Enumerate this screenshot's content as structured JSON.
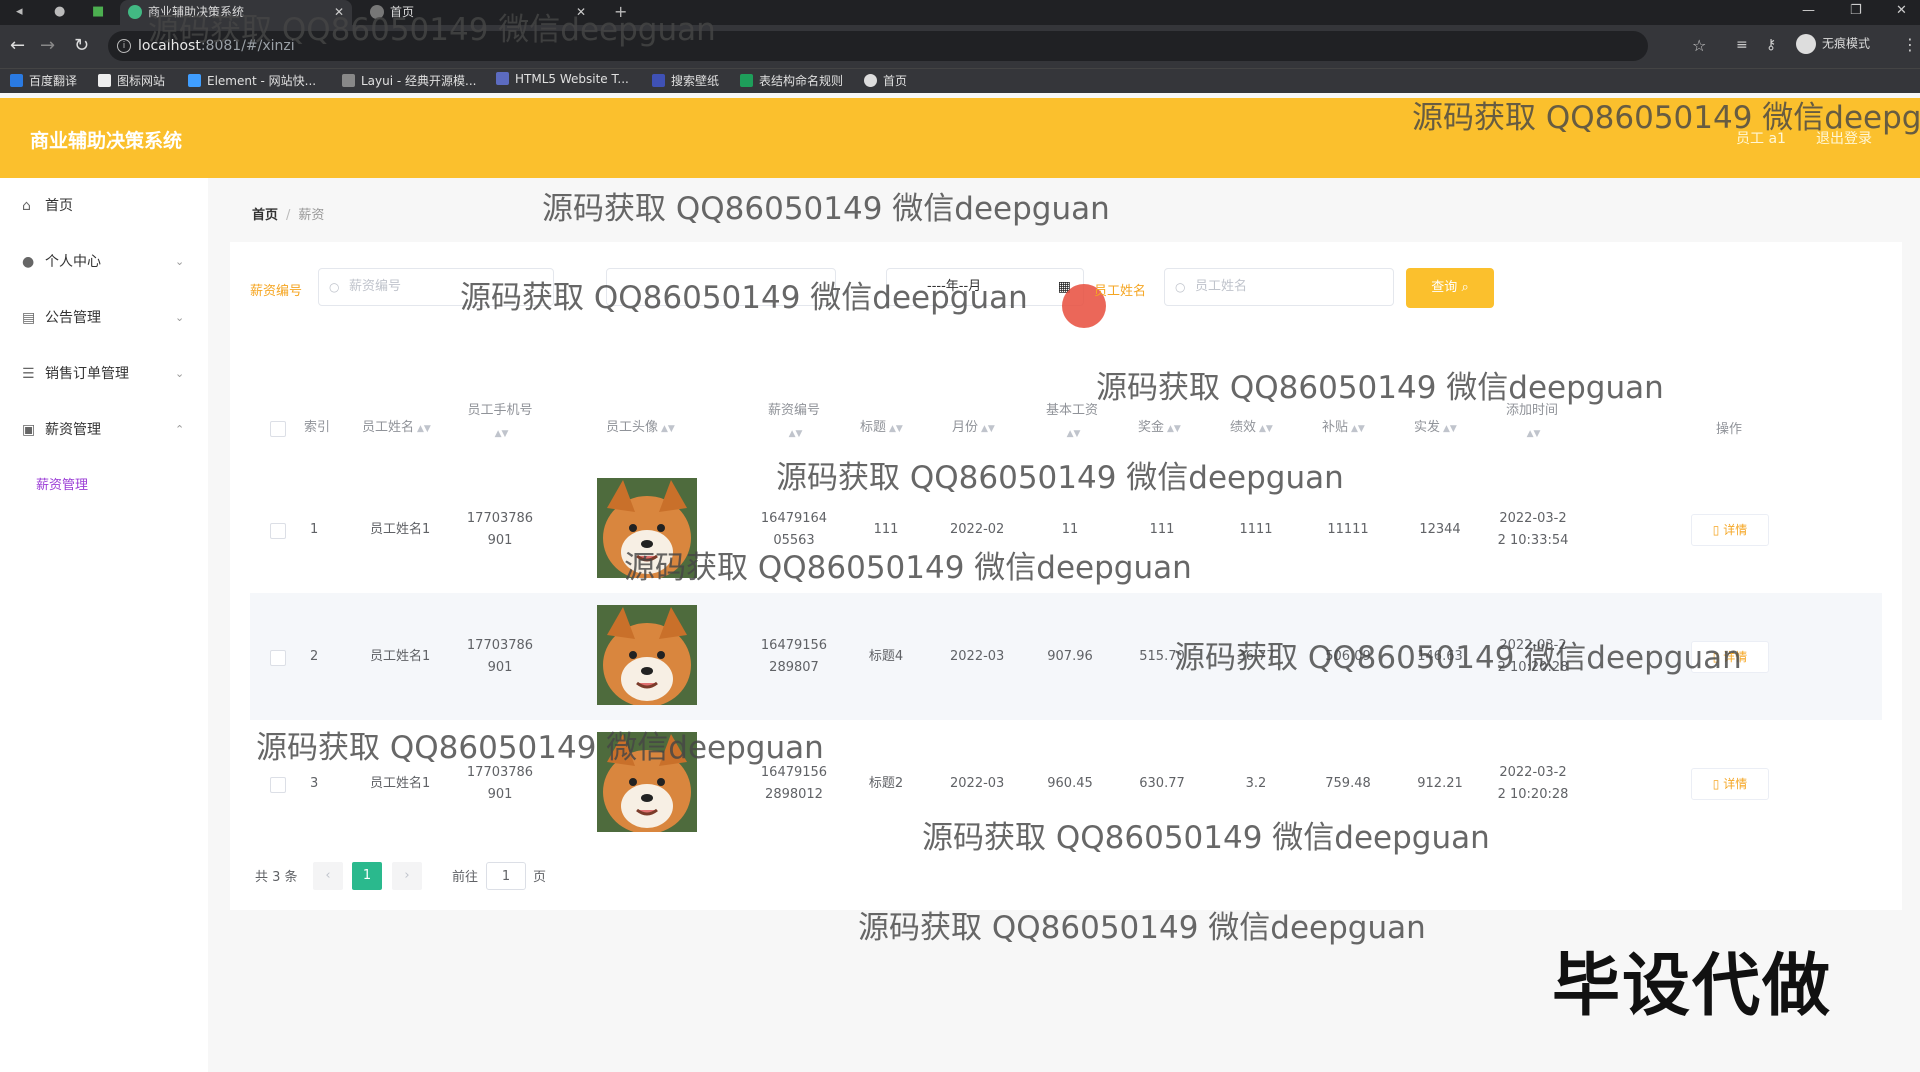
{
  "browser": {
    "tabs": [
      {
        "title": "商业辅助决策系统",
        "active": true
      },
      {
        "title": "首页",
        "active": false
      }
    ],
    "url_host": "localhost",
    "url_rest": ":8081/#/xinzi",
    "profile_label": "无痕模式",
    "bookmarks": [
      "百度翻译",
      "图标网站",
      "Element - 网站快...",
      "Layui - 经典开源模...",
      "HTML5 Website T...",
      "搜索壁纸",
      "表结构命名规则",
      "首页"
    ]
  },
  "header": {
    "title": "商业辅助决策系统",
    "user": "员工 a1",
    "logout": "退出登录"
  },
  "sidebar": {
    "items": [
      {
        "label": "首页",
        "icon": "home-icon"
      },
      {
        "label": "个人中心",
        "icon": "user-icon"
      },
      {
        "label": "公告管理",
        "icon": "notice-icon"
      },
      {
        "label": "销售订单管理",
        "icon": "list-icon"
      },
      {
        "label": "薪资管理",
        "icon": "salary-icon"
      }
    ],
    "sub_item": "薪资管理"
  },
  "breadcrumb": {
    "home": "首页",
    "current": "薪资"
  },
  "filters": {
    "salary_no_label": "薪资编号",
    "salary_no_placeholder": "薪资编号",
    "month_value": "----年--月",
    "employee_name_label": "员工姓名",
    "employee_name_placeholder": "员工姓名",
    "query_button": "查询"
  },
  "table": {
    "headers": {
      "index": "索引",
      "name": "员工姓名",
      "phone": "员工手机号",
      "avatar": "员工头像",
      "salary_no": "薪资编号",
      "title": "标题",
      "month": "月份",
      "base": "基本工资",
      "bonus": "奖金",
      "performance": "绩效",
      "subsidy": "补贴",
      "actual": "实发",
      "added_time": "添加时间",
      "action": "操作"
    },
    "rows": [
      {
        "index": "1",
        "name": "员工姓名1",
        "phone_l1": "17703786",
        "phone_l2": "901",
        "salary_no_l1": "16479164",
        "salary_no_l2": "05563",
        "title": "111",
        "month": "2022-02",
        "base": "11",
        "bonus": "111",
        "performance": "1111",
        "subsidy": "11111",
        "actual": "12344",
        "time_l1": "2022-03-2",
        "time_l2": "2 10:33:54",
        "action": "详情"
      },
      {
        "index": "2",
        "name": "员工姓名1",
        "phone_l1": "17703786",
        "phone_l2": "901",
        "salary_no_l1": "16479156",
        "salary_no_l2": "289807",
        "title": "标题4",
        "month": "2022-03",
        "base": "907.96",
        "bonus": "515.70",
        "performance": "36.77",
        "subsidy": "506.09",
        "actual": "146.63",
        "time_l1": "2022-03-2",
        "time_l2": "2 10:20:28",
        "action": "详情"
      },
      {
        "index": "3",
        "name": "员工姓名1",
        "phone_l1": "17703786",
        "phone_l2": "901",
        "salary_no_l1": "16479156",
        "salary_no_l2": "2898012",
        "title": "标题2",
        "month": "2022-03",
        "base": "960.45",
        "bonus": "630.77",
        "performance": "3.2",
        "subsidy": "759.48",
        "actual": "912.21",
        "time_l1": "2022-03-2",
        "time_l2": "2 10:20:28",
        "action": "详情"
      }
    ]
  },
  "pagination": {
    "total": "共 3 条",
    "current": "1",
    "goto_label": "前往",
    "goto_value": "1",
    "page_suffix": "页"
  },
  "watermark": "源码获取 QQ86050149 微信deepguan",
  "stamp": "毕设代做",
  "colors": {
    "header": "#fbc02d",
    "accent": "#f5a623",
    "active_page": "#2ab98d",
    "sub_menu": "#9b3dd6"
  }
}
